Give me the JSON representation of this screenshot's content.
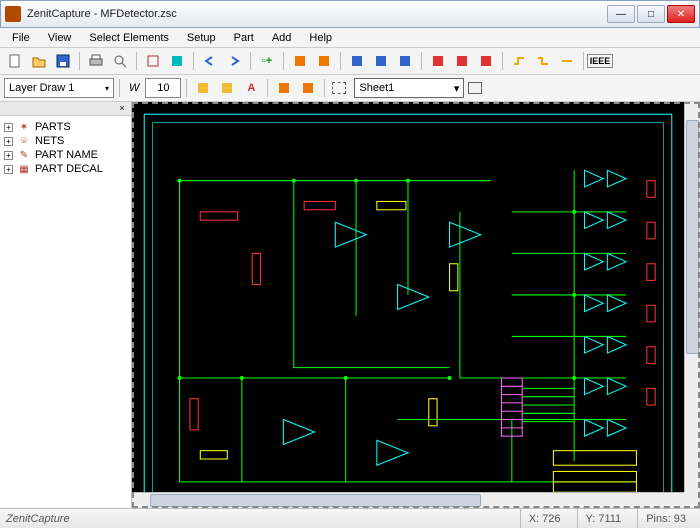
{
  "window": {
    "title": "ZenitCapture - MFDetector.zsc"
  },
  "menu": [
    "File",
    "View",
    "Select Elements",
    "Setup",
    "Part",
    "Add",
    "Help"
  ],
  "toolbar2": {
    "layer_label": "Layer Draw 1",
    "w_label": "W",
    "w_value": "10",
    "sheet_label": "Sheet1"
  },
  "tree": [
    {
      "label": "PARTS"
    },
    {
      "label": "NETS"
    },
    {
      "label": "PART NAME"
    },
    {
      "label": "PART DECAL"
    }
  ],
  "status": {
    "app": "ZenitCapture",
    "x_label": "X:",
    "x_value": "726",
    "y_label": "Y:",
    "y_value": "7111",
    "pins_label": "Pins:",
    "pins_value": "93"
  },
  "icons": {
    "min": "—",
    "max": "□",
    "close": "✕",
    "dd": "▾",
    "plus": "+"
  }
}
